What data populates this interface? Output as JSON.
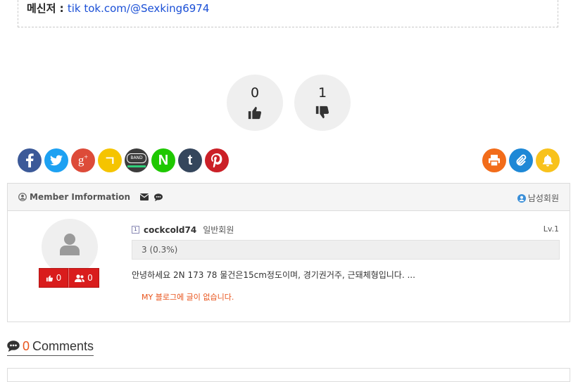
{
  "messenger": {
    "label": "메신저 : ",
    "value": "tik tok.com/@Sexking6974"
  },
  "vote": {
    "up_count": "0",
    "down_count": "1"
  },
  "social": {
    "share": [
      {
        "name": "facebook",
        "color": "#3b5998"
      },
      {
        "name": "twitter",
        "color": "#1da1f2"
      },
      {
        "name": "google-plus",
        "color": "#dd4b39"
      },
      {
        "name": "kakaostory",
        "color": "#f5c400"
      },
      {
        "name": "band",
        "color": "#3c3c3c"
      },
      {
        "name": "naver",
        "color": "#1ec800"
      },
      {
        "name": "tumblr",
        "color": "#35465c"
      },
      {
        "name": "pinterest",
        "color": "#cb2027"
      }
    ],
    "tools": [
      {
        "name": "print",
        "color": "#f26c1a"
      },
      {
        "name": "clip",
        "color": "#1e88d6"
      },
      {
        "name": "alarm",
        "color": "#f8c21c"
      }
    ],
    "band_label": "BAND",
    "naver_label": "N",
    "tumblr_label": "t",
    "kakao_label": "ㄱ"
  },
  "member": {
    "heading": "Member Imformation",
    "gender": "남성회원",
    "level_badge": "1",
    "username": "cockcold74",
    "grade": "일반회원",
    "level": "Lv.1",
    "points": "3 (0.3%)",
    "like_count": "0",
    "follow_count": "0",
    "intro": "안녕하세요 2N 173 78 물건은15cm정도이며, 경기권거주, 근돼체형입니다. ...",
    "blog_message": "MY 블로그에 글이 없습니다."
  },
  "comments": {
    "count": "0",
    "label": "Comments"
  }
}
